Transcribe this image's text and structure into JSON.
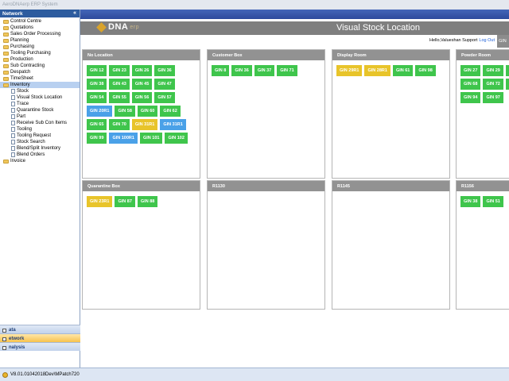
{
  "window": {
    "title": "AeroDNAerp ERP System"
  },
  "nav": {
    "header": "Network",
    "collapse_glyph": "«",
    "items": [
      {
        "label": "Control Centre",
        "level": 0
      },
      {
        "label": "Quotations",
        "level": 0
      },
      {
        "label": "Sales Order Processing",
        "level": 0
      },
      {
        "label": "Planning",
        "level": 0
      },
      {
        "label": "Purchasing",
        "level": 0
      },
      {
        "label": "Tooling Purchasing",
        "level": 0
      },
      {
        "label": "Production",
        "level": 0
      },
      {
        "label": "Sub Contracting",
        "level": 0
      },
      {
        "label": "Despatch",
        "level": 0
      },
      {
        "label": "TimeSheet",
        "level": 0
      },
      {
        "label": "Inventory",
        "level": 0,
        "selected": true
      },
      {
        "label": "Stock",
        "level": 1
      },
      {
        "label": "Visual Stock Location",
        "level": 1
      },
      {
        "label": "Trace",
        "level": 1
      },
      {
        "label": "Quarantine Stock",
        "level": 1
      },
      {
        "label": "Part",
        "level": 1
      },
      {
        "label": "Receive Sub Con Items",
        "level": 1
      },
      {
        "label": "Tooling",
        "level": 1
      },
      {
        "label": "Tooling Request",
        "level": 1
      },
      {
        "label": "Stock Search",
        "level": 1
      },
      {
        "label": "Blend/Split Inventory",
        "level": 1
      },
      {
        "label": "Blend Orders",
        "level": 1
      },
      {
        "label": "Invoice",
        "level": 0
      }
    ],
    "bottom": [
      {
        "label": "ata",
        "active": false
      },
      {
        "label": "etwork",
        "active": true
      },
      {
        "label": "nalysis",
        "active": false
      }
    ]
  },
  "status": {
    "version": "V8.01.01042018Dev\\MPatch720"
  },
  "header": {
    "logo_text": "DNA",
    "logo_suffix": "erp",
    "page_title": "Visual Stock Location",
    "greeting": "Hello,Valueshan Support",
    "logout": "Log Out",
    "tab": "GIN"
  },
  "colors": {
    "green": "#3fc54c",
    "yellow": "#e8c42a",
    "blue": "#4aa1e8"
  },
  "locations": [
    {
      "name": "No Location",
      "tags": [
        {
          "label": "GIN 12",
          "color": "green"
        },
        {
          "label": "GIN 23",
          "color": "green"
        },
        {
          "label": "GIN 26",
          "color": "green"
        },
        {
          "label": "GIN 36",
          "color": "green"
        },
        {
          "label": "GIN 38",
          "color": "green"
        },
        {
          "label": "GIN 43",
          "color": "green"
        },
        {
          "label": "GIN 45",
          "color": "green"
        },
        {
          "label": "GIN 47",
          "color": "green"
        },
        {
          "label": "GIN 54",
          "color": "green"
        },
        {
          "label": "GIN 55",
          "color": "green"
        },
        {
          "label": "GIN 56",
          "color": "green"
        },
        {
          "label": "GIN 57",
          "color": "green"
        },
        {
          "label": "GIN 20R1",
          "color": "blue"
        },
        {
          "label": "GIN 58",
          "color": "green"
        },
        {
          "label": "GIN 60",
          "color": "green"
        },
        {
          "label": "GIN 62",
          "color": "green"
        },
        {
          "label": "GIN 65",
          "color": "green"
        },
        {
          "label": "GIN 70",
          "color": "green"
        },
        {
          "label": "GIN 31R1",
          "color": "yellow"
        },
        {
          "label": "GIN 31R1",
          "color": "blue"
        },
        {
          "label": "GIN 99",
          "color": "green"
        },
        {
          "label": "GIN 100R1",
          "color": "blue"
        },
        {
          "label": "GIN 101",
          "color": "green"
        },
        {
          "label": "GIN 102",
          "color": "green"
        }
      ]
    },
    {
      "name": "Customer Box",
      "tags": [
        {
          "label": "GIN 8",
          "color": "green"
        },
        {
          "label": "GIN 36",
          "color": "green"
        },
        {
          "label": "GIN 37",
          "color": "green"
        },
        {
          "label": "GIN 71",
          "color": "green"
        }
      ]
    },
    {
      "name": "Display Room",
      "tags": [
        {
          "label": "GIN 29R1",
          "color": "yellow"
        },
        {
          "label": "GIN 28R1",
          "color": "yellow"
        },
        {
          "label": "GIN 61",
          "color": "green"
        },
        {
          "label": "GIN 98",
          "color": "green"
        }
      ]
    },
    {
      "name": "Powder Room",
      "tags": [
        {
          "label": "GIN 27",
          "color": "green"
        },
        {
          "label": "GIN 29",
          "color": "green"
        },
        {
          "label": "GIN 52",
          "color": "green"
        },
        {
          "label": "GIN 29R1",
          "color": "yellow"
        },
        {
          "label": "GIN 68",
          "color": "green"
        },
        {
          "label": "GIN 72",
          "color": "green"
        },
        {
          "label": "GIN 82",
          "color": "green"
        },
        {
          "label": "GIN 75R1",
          "color": "blue"
        },
        {
          "label": "GIN 94",
          "color": "green"
        },
        {
          "label": "GIN 97",
          "color": "green"
        }
      ]
    },
    {
      "name": "Quarantine Box",
      "tags": [
        {
          "label": "GIN 23R1",
          "color": "yellow"
        },
        {
          "label": "GIN 87",
          "color": "green"
        },
        {
          "label": "GIN 88",
          "color": "green"
        }
      ]
    },
    {
      "name": "R1130",
      "tags": []
    },
    {
      "name": "R1145",
      "tags": []
    },
    {
      "name": "R1156",
      "tags": [
        {
          "label": "GIN 38",
          "color": "green"
        },
        {
          "label": "GIN 51",
          "color": "green"
        }
      ]
    }
  ]
}
